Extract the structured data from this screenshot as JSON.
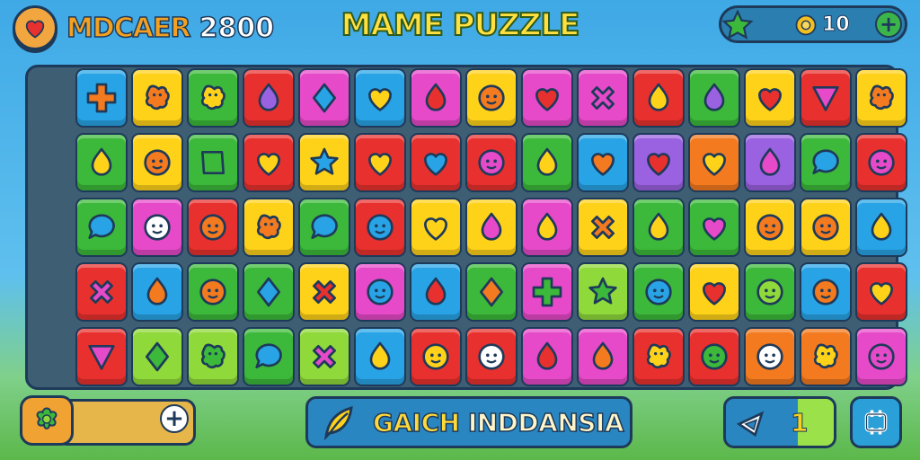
{
  "hud": {
    "player_name": "MDCAER",
    "score": "2800",
    "title": "MAME PUZZLE",
    "coins": "10",
    "heart_icon": "heart-icon",
    "star_icon": "star-icon",
    "coin_icon": "gear-coin-icon",
    "plus_label": "+"
  },
  "bottom": {
    "left_plus_label": "+",
    "mission_text_a": "GAICH",
    "mission_text_b": "INDDANSIA",
    "counter": "1",
    "counter_fill_fraction": 0.33,
    "shuffle_icon": "shuffle-icon"
  },
  "colors": {
    "red": "#e8312e",
    "orange": "#f37a1f",
    "yellow": "#ffd21a",
    "green": "#3cb93a",
    "lime": "#8fd93a",
    "blue": "#28a4e6",
    "purple": "#9a62e0",
    "pink": "#e64ac9"
  },
  "board": {
    "rows": 5,
    "cols": 15,
    "tiles": [
      [
        {
          "c": "blue",
          "s": "cross",
          "f": "orange"
        },
        {
          "c": "yellow",
          "s": "blob",
          "f": "orange"
        },
        {
          "c": "green",
          "s": "blob",
          "f": "yellow"
        },
        {
          "c": "red",
          "s": "drop",
          "f": "purple"
        },
        {
          "c": "pink",
          "s": "diamond",
          "f": "blue"
        },
        {
          "c": "blue",
          "s": "heart",
          "f": "yellow"
        },
        {
          "c": "pink",
          "s": "drop",
          "f": "red"
        },
        {
          "c": "yellow",
          "s": "face",
          "f": "orange"
        },
        {
          "c": "pink",
          "s": "heart",
          "f": "red"
        },
        {
          "c": "pink",
          "s": "x",
          "f": "pink"
        },
        {
          "c": "red",
          "s": "drop",
          "f": "yellow"
        },
        {
          "c": "green",
          "s": "drop",
          "f": "purple"
        },
        {
          "c": "yellow",
          "s": "heart",
          "f": "red"
        },
        {
          "c": "red",
          "s": "triangle",
          "f": "pink"
        },
        {
          "c": "yellow",
          "s": "blob",
          "f": "orange"
        }
      ],
      [
        {
          "c": "green",
          "s": "drop",
          "f": "yellow"
        },
        {
          "c": "yellow",
          "s": "face",
          "f": "orange"
        },
        {
          "c": "green",
          "s": "square",
          "f": "green"
        },
        {
          "c": "red",
          "s": "heart",
          "f": "yellow"
        },
        {
          "c": "yellow",
          "s": "star",
          "f": "blue"
        },
        {
          "c": "red",
          "s": "heart",
          "f": "yellow"
        },
        {
          "c": "red",
          "s": "heart",
          "f": "blue"
        },
        {
          "c": "red",
          "s": "face",
          "f": "pink"
        },
        {
          "c": "green",
          "s": "drop",
          "f": "yellow"
        },
        {
          "c": "blue",
          "s": "heart",
          "f": "orange"
        },
        {
          "c": "purple",
          "s": "heart",
          "f": "red"
        },
        {
          "c": "orange",
          "s": "heart",
          "f": "yellow"
        },
        {
          "c": "purple",
          "s": "drop",
          "f": "pink"
        },
        {
          "c": "green",
          "s": "bubble",
          "f": "blue"
        },
        {
          "c": "red",
          "s": "face",
          "f": "pink"
        }
      ],
      [
        {
          "c": "green",
          "s": "bubble",
          "f": "blue"
        },
        {
          "c": "pink",
          "s": "face",
          "f": "white"
        },
        {
          "c": "red",
          "s": "face",
          "f": "orange"
        },
        {
          "c": "yellow",
          "s": "blob",
          "f": "orange"
        },
        {
          "c": "green",
          "s": "bubble",
          "f": "blue"
        },
        {
          "c": "red",
          "s": "face",
          "f": "blue"
        },
        {
          "c": "yellow",
          "s": "heart",
          "f": "yellow"
        },
        {
          "c": "yellow",
          "s": "drop",
          "f": "pink"
        },
        {
          "c": "pink",
          "s": "drop",
          "f": "yellow"
        },
        {
          "c": "yellow",
          "s": "x",
          "f": "orange"
        },
        {
          "c": "green",
          "s": "drop",
          "f": "yellow"
        },
        {
          "c": "green",
          "s": "heart",
          "f": "pink"
        },
        {
          "c": "yellow",
          "s": "face",
          "f": "orange"
        },
        {
          "c": "yellow",
          "s": "face",
          "f": "orange"
        },
        {
          "c": "blue",
          "s": "drop",
          "f": "yellow"
        }
      ],
      [
        {
          "c": "red",
          "s": "x",
          "f": "pink"
        },
        {
          "c": "blue",
          "s": "drop",
          "f": "orange"
        },
        {
          "c": "green",
          "s": "face",
          "f": "orange"
        },
        {
          "c": "green",
          "s": "diamond",
          "f": "blue"
        },
        {
          "c": "yellow",
          "s": "x",
          "f": "red"
        },
        {
          "c": "pink",
          "s": "face",
          "f": "blue"
        },
        {
          "c": "blue",
          "s": "drop",
          "f": "red"
        },
        {
          "c": "green",
          "s": "diamond",
          "f": "orange"
        },
        {
          "c": "pink",
          "s": "cross",
          "f": "green"
        },
        {
          "c": "lime",
          "s": "star",
          "f": "green"
        },
        {
          "c": "green",
          "s": "face",
          "f": "blue"
        },
        {
          "c": "yellow",
          "s": "heart",
          "f": "red"
        },
        {
          "c": "green",
          "s": "face",
          "f": "lime"
        },
        {
          "c": "blue",
          "s": "face",
          "f": "orange"
        },
        {
          "c": "red",
          "s": "heart",
          "f": "yellow"
        }
      ],
      [
        {
          "c": "red",
          "s": "triangle",
          "f": "pink"
        },
        {
          "c": "lime",
          "s": "diamond",
          "f": "green"
        },
        {
          "c": "lime",
          "s": "blob",
          "f": "green"
        },
        {
          "c": "green",
          "s": "bubble",
          "f": "blue"
        },
        {
          "c": "lime",
          "s": "x",
          "f": "pink"
        },
        {
          "c": "blue",
          "s": "drop",
          "f": "yellow"
        },
        {
          "c": "red",
          "s": "face",
          "f": "yellow"
        },
        {
          "c": "red",
          "s": "face",
          "f": "white"
        },
        {
          "c": "pink",
          "s": "drop",
          "f": "red"
        },
        {
          "c": "pink",
          "s": "drop",
          "f": "orange"
        },
        {
          "c": "red",
          "s": "blob",
          "f": "yellow"
        },
        {
          "c": "red",
          "s": "face",
          "f": "green"
        },
        {
          "c": "orange",
          "s": "face",
          "f": "white"
        },
        {
          "c": "orange",
          "s": "blob",
          "f": "yellow"
        },
        {
          "c": "pink",
          "s": "face",
          "f": "pink"
        }
      ]
    ]
  }
}
